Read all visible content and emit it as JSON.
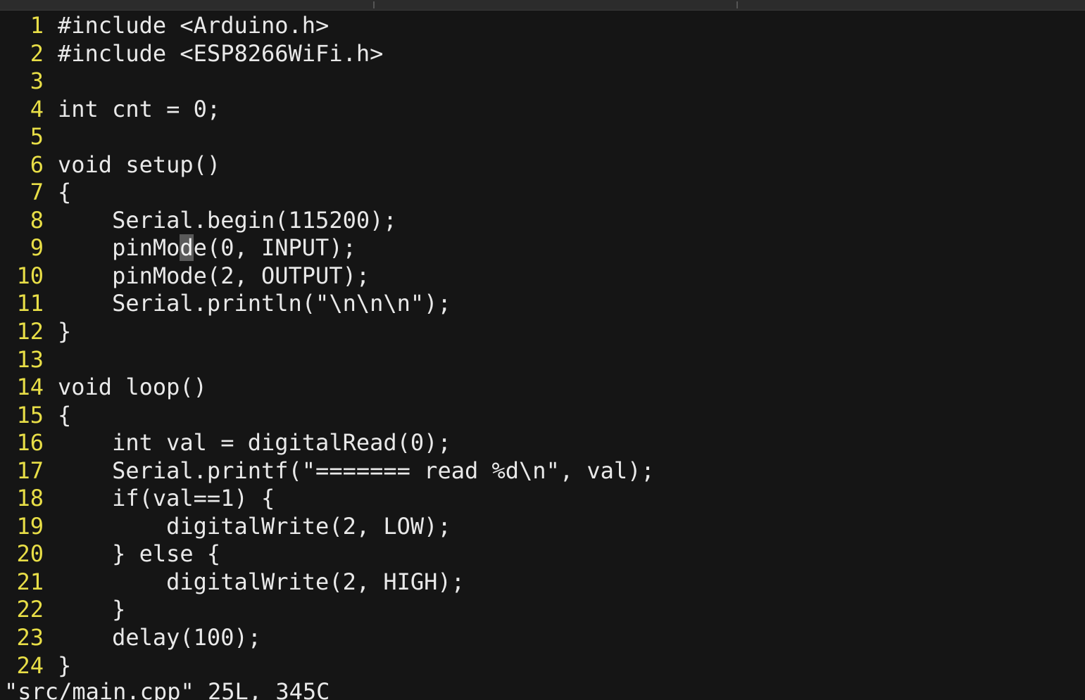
{
  "editor": {
    "lines": [
      {
        "num": "1",
        "text": "#include <Arduino.h>"
      },
      {
        "num": "2",
        "text": "#include <ESP8266WiFi.h>"
      },
      {
        "num": "3",
        "text": ""
      },
      {
        "num": "4",
        "text": "int cnt = 0;"
      },
      {
        "num": "5",
        "text": ""
      },
      {
        "num": "6",
        "text": "void setup()"
      },
      {
        "num": "7",
        "text": "{"
      },
      {
        "num": "8",
        "text": "    Serial.begin(115200);"
      },
      {
        "num": "9",
        "text": "    pinMode(0, INPUT);",
        "cursor_col": 9
      },
      {
        "num": "10",
        "text": "    pinMode(2, OUTPUT);"
      },
      {
        "num": "11",
        "text": "    Serial.println(\"\\n\\n\\n\");"
      },
      {
        "num": "12",
        "text": "}"
      },
      {
        "num": "13",
        "text": ""
      },
      {
        "num": "14",
        "text": "void loop()"
      },
      {
        "num": "15",
        "text": "{"
      },
      {
        "num": "16",
        "text": "    int val = digitalRead(0);"
      },
      {
        "num": "17",
        "text": "    Serial.printf(\"======= read %d\\n\", val);"
      },
      {
        "num": "18",
        "text": "    if(val==1) {"
      },
      {
        "num": "19",
        "text": "        digitalWrite(2, LOW);"
      },
      {
        "num": "20",
        "text": "    } else {"
      },
      {
        "num": "21",
        "text": "        digitalWrite(2, HIGH);"
      },
      {
        "num": "22",
        "text": "    }"
      },
      {
        "num": "23",
        "text": "    delay(100);"
      },
      {
        "num": "24",
        "text": "}"
      }
    ]
  },
  "status_bar": {
    "text": "\"src/main.cpp\" 25L, 345C"
  },
  "colors": {
    "background": "#151515",
    "line_number": "#e8de47",
    "code_text": "#e9e9e9",
    "cursor": "#5a5a5a"
  }
}
